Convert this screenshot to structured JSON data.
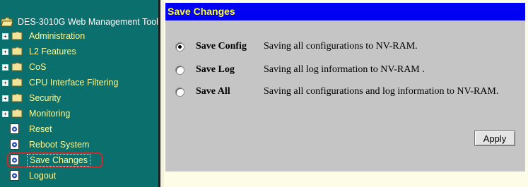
{
  "tree": {
    "root": "DES-3010G Web Management Tool",
    "items": [
      {
        "label": "Administration",
        "type": "folder"
      },
      {
        "label": "L2 Features",
        "type": "folder"
      },
      {
        "label": "CoS",
        "type": "folder"
      },
      {
        "label": "CPU Interface Filtering",
        "type": "folder"
      },
      {
        "label": "Security",
        "type": "folder"
      },
      {
        "label": "Monitoring",
        "type": "folder"
      },
      {
        "label": "Reset",
        "type": "page"
      },
      {
        "label": "Reboot System",
        "type": "page"
      },
      {
        "label": "Save Changes",
        "type": "page",
        "selected": true
      },
      {
        "label": "Logout",
        "type": "page"
      }
    ]
  },
  "page": {
    "title": "Save Changes",
    "options": [
      {
        "name": "Save Config",
        "description": "Saving all configurations to NV-RAM.",
        "checked": true
      },
      {
        "name": "Save Log",
        "description": "Saving all log information to NV-RAM .",
        "checked": false
      },
      {
        "name": "Save All",
        "description": "Saving all configurations and log information to NV-RAM.",
        "checked": false
      }
    ],
    "apply_label": "Apply"
  },
  "colors": {
    "sidebar_bg": "#0b6f6d",
    "sidebar_text": "#fbfb98",
    "header_bg": "#0000f2",
    "header_text": "#ffff2e",
    "content_bg": "#c5c5c5",
    "selection_outline": "#c52c2c"
  }
}
